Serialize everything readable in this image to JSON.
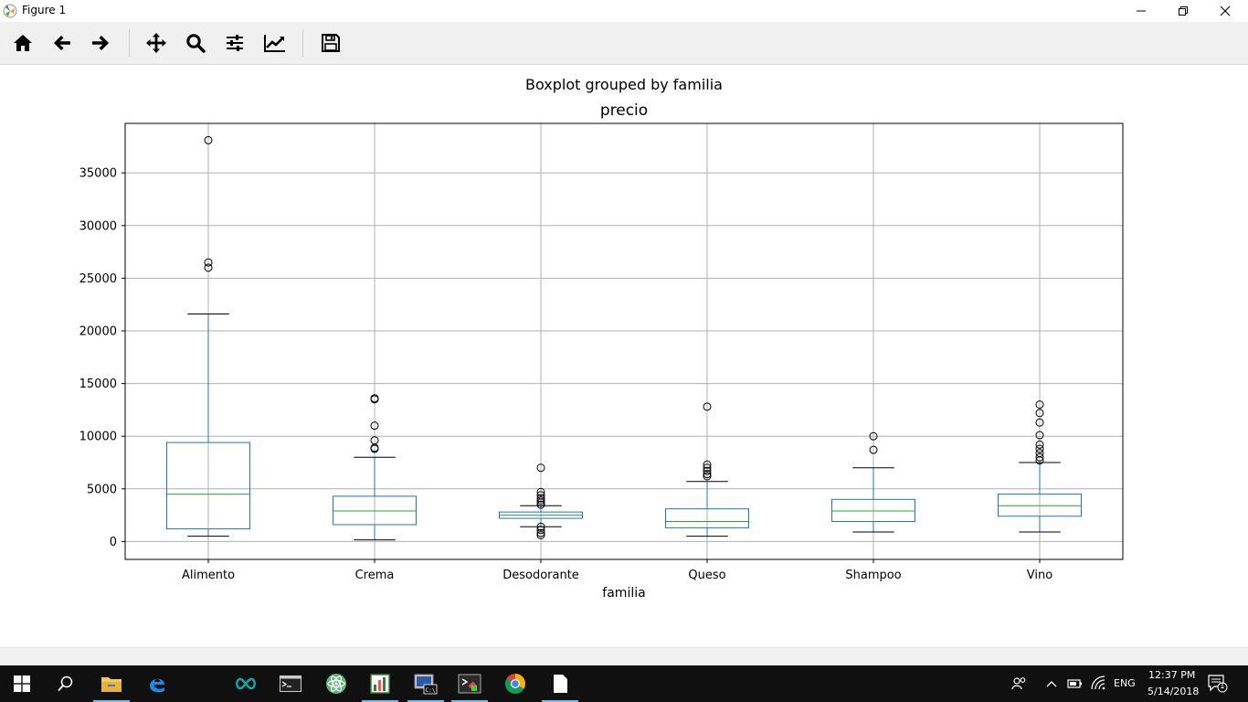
{
  "window": {
    "title": "Figure 1",
    "controls": [
      "minimize",
      "restore",
      "close"
    ]
  },
  "toolbar": {
    "buttons": [
      {
        "name": "home",
        "icon": "home-icon"
      },
      {
        "name": "back",
        "icon": "arrow-left-icon"
      },
      {
        "name": "forward",
        "icon": "arrow-right-icon"
      },
      {
        "name": "pan",
        "icon": "move-icon"
      },
      {
        "name": "zoom",
        "icon": "magnifier-icon"
      },
      {
        "name": "subplots",
        "icon": "sliders-icon"
      },
      {
        "name": "edit-axes",
        "icon": "line-chart-icon"
      },
      {
        "name": "save",
        "icon": "floppy-disk-icon"
      }
    ]
  },
  "chart_data": {
    "type": "box",
    "suptitle": "Boxplot grouped by familia",
    "title": "precio",
    "xlabel": "familia",
    "ylabel": "",
    "ylim": [
      -1700,
      39700
    ],
    "yticks": [
      0,
      5000,
      10000,
      15000,
      20000,
      25000,
      30000,
      35000
    ],
    "grid": true,
    "box_color": "#1f77b4",
    "median_color": "#2ca02c",
    "categories": [
      "Alimento",
      "Crema",
      "Desodorante",
      "Queso",
      "Shampoo",
      "Vino"
    ],
    "boxes": [
      {
        "label": "Alimento",
        "whisker_low": 500,
        "q1": 1200,
        "median": 4500,
        "q3": 9400,
        "whisker_high": 21600,
        "outliers": [
          26000,
          26500,
          38100
        ]
      },
      {
        "label": "Crema",
        "whisker_low": 150,
        "q1": 1600,
        "median": 2900,
        "q3": 4300,
        "whisker_high": 8000,
        "outliers": [
          8800,
          8900,
          9600,
          11000,
          13500,
          13600
        ]
      },
      {
        "label": "Desodorante",
        "whisker_low": 1400,
        "q1": 2200,
        "median": 2500,
        "q3": 2800,
        "whisker_high": 3400,
        "outliers": [
          600,
          800,
          1100,
          1400,
          3500,
          3700,
          3900,
          4100,
          4400,
          4700,
          7000
        ]
      },
      {
        "label": "Queso",
        "whisker_low": 500,
        "q1": 1300,
        "median": 1900,
        "q3": 3100,
        "whisker_high": 5700,
        "outliers": [
          6200,
          6400,
          6700,
          7000,
          7300,
          12800
        ]
      },
      {
        "label": "Shampoo",
        "whisker_low": 900,
        "q1": 1900,
        "median": 2900,
        "q3": 4000,
        "whisker_high": 7000,
        "outliers": [
          8700,
          10000
        ]
      },
      {
        "label": "Vino",
        "whisker_low": 900,
        "q1": 2400,
        "median": 3400,
        "q3": 4500,
        "whisker_high": 7500,
        "outliers": [
          7700,
          8000,
          8400,
          8800,
          9200,
          10100,
          11300,
          12200,
          13000
        ]
      }
    ]
  },
  "taskbar": {
    "items": [
      {
        "name": "start",
        "icon": "windows-logo-icon"
      },
      {
        "name": "search",
        "icon": "search-icon"
      },
      {
        "name": "file-explorer",
        "icon": "folder-icon",
        "active": true
      },
      {
        "name": "edge",
        "icon": "edge-icon"
      },
      {
        "name": "arduino",
        "icon": "infinity-icon"
      },
      {
        "name": "terminal",
        "icon": "terminal-icon"
      },
      {
        "name": "atom",
        "icon": "atom-icon"
      },
      {
        "name": "sheet-app",
        "icon": "chart-sheet-icon",
        "active": true
      },
      {
        "name": "cmd-app",
        "icon": "console-icon",
        "active": true
      },
      {
        "name": "python-app",
        "icon": "python-window-icon",
        "active": true
      },
      {
        "name": "chrome",
        "icon": "chrome-icon"
      },
      {
        "name": "document",
        "icon": "document-icon",
        "active": true
      }
    ],
    "language": "ENG",
    "time": "12:37 PM",
    "date": "5/14/2018",
    "notifications": "1"
  }
}
